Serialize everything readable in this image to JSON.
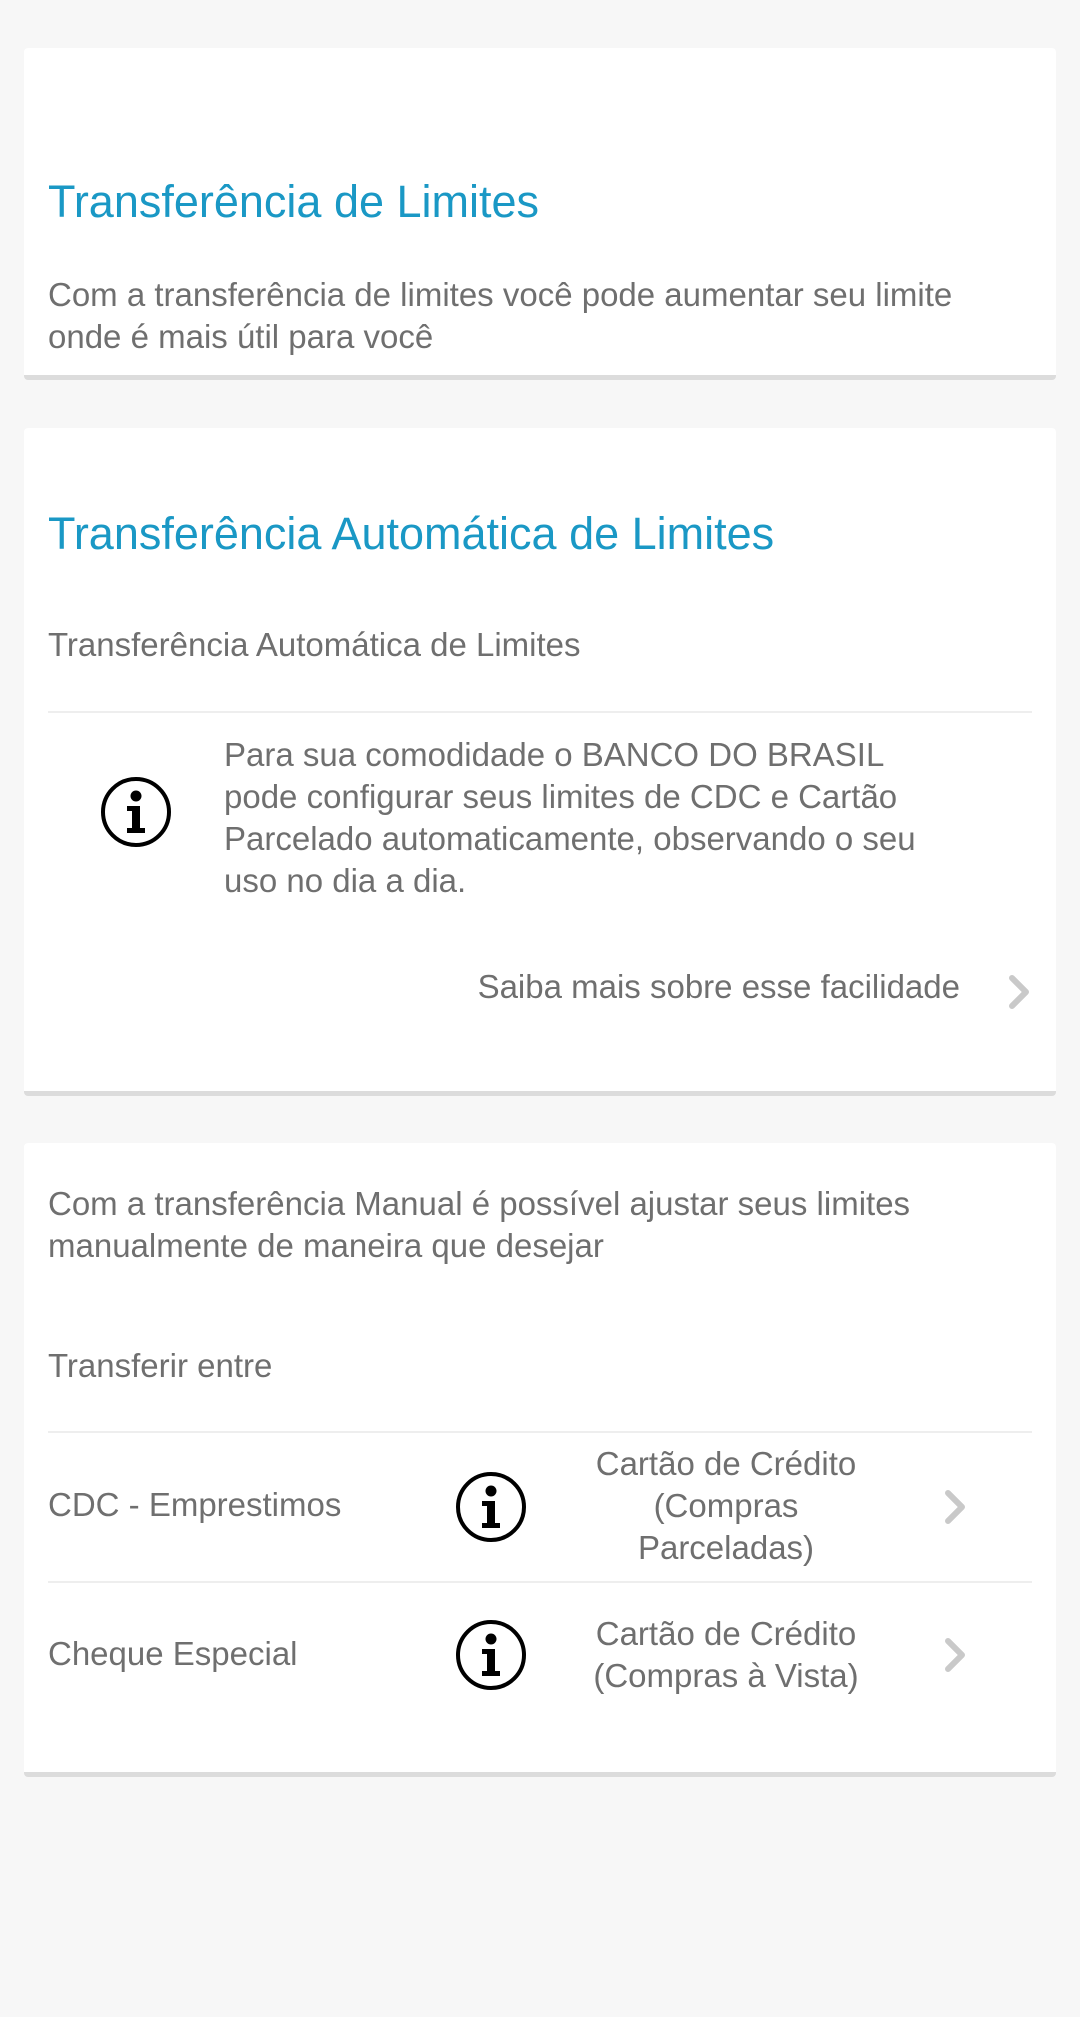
{
  "card1": {
    "title": "Transferência de Limites",
    "description": "Com a transferência de limites você pode aumentar seu limite onde é mais útil para você"
  },
  "card2": {
    "title": "Transferência Automática de Limites",
    "subtitle": "Transferência Automática de Limites",
    "info_text": "Para sua comodidade o BANCO DO BRASIL pode configurar seus limites de CDC e Cartão Parcelado automaticamente, observando o seu uso no dia a dia.",
    "link_label": "Saiba mais sobre esse facilidade"
  },
  "card3": {
    "description": "Com a transferência Manual é possível ajustar seus limites manualmente de maneira que desejar",
    "section_label": "Transferir entre",
    "rows": [
      {
        "from": "CDC - Emprestimos",
        "to": "Cartão de Crédito\n(Compras\nParceladas)"
      },
      {
        "from": "Cheque Especial",
        "to": "Cartão de Crédito\n(Compras à Vista)"
      }
    ]
  },
  "icons": {
    "info": "info-circle-icon",
    "chevron": "chevron-right-icon"
  },
  "colors": {
    "accent": "#1a98c5",
    "text": "#6f6f6f",
    "background": "#f7f7f7",
    "card": "#ffffff",
    "chevron": "#c9c9c9"
  }
}
